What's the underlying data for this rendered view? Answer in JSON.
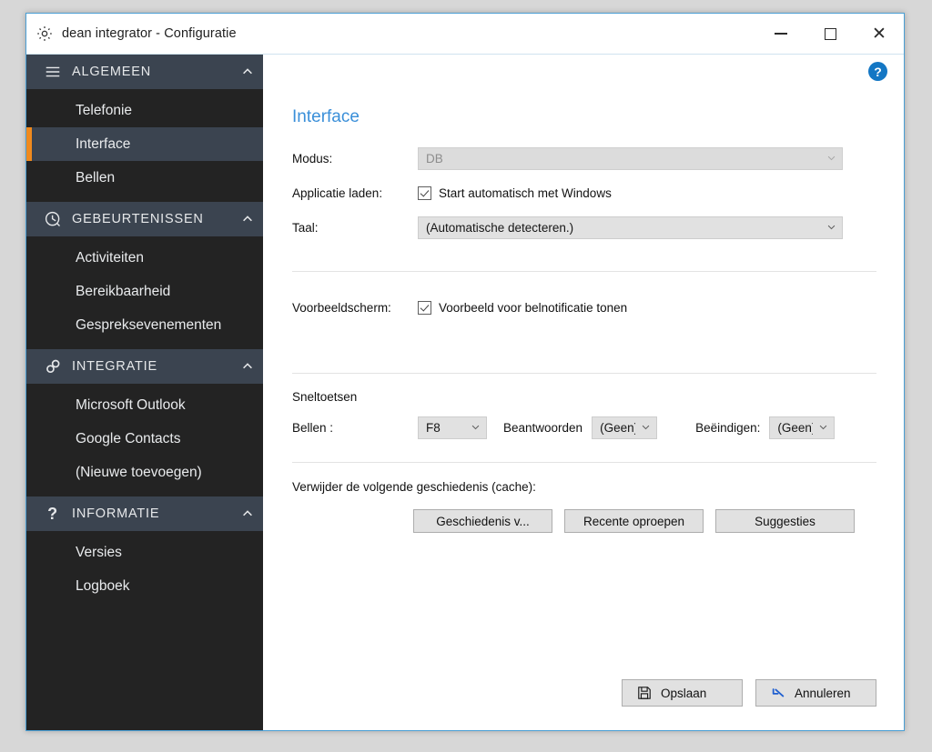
{
  "window": {
    "title": "dean integrator - Configuratie",
    "title_icon": "gear-icon",
    "minimize_label": "—",
    "maximize_label": "□",
    "close_label": "✕"
  },
  "help": {
    "label": "?"
  },
  "sidebar": {
    "sections": [
      {
        "label": "ALGEMEEN",
        "icon": "hamburger-icon",
        "chevron": "chevron-up-icon",
        "items": [
          {
            "label": "Telefonie",
            "selected": false
          },
          {
            "label": "Interface",
            "selected": true
          },
          {
            "label": "Bellen",
            "selected": false
          }
        ]
      },
      {
        "label": "GEBEURTENISSEN",
        "icon": "event-clock-icon",
        "chevron": "chevron-up-icon",
        "items": [
          {
            "label": "Activiteiten",
            "selected": false
          },
          {
            "label": "Bereikbaarheid",
            "selected": false
          },
          {
            "label": "Gespreksevenementen",
            "selected": false
          }
        ]
      },
      {
        "label": "INTEGRATIE",
        "icon": "chain-link-icon",
        "chevron": "chevron-up-icon",
        "items": [
          {
            "label": "Microsoft Outlook",
            "selected": false
          },
          {
            "label": "Google Contacts",
            "selected": false
          },
          {
            "label": "(Nieuwe toevoegen)",
            "selected": false
          }
        ]
      },
      {
        "label": "INFORMATIE",
        "icon": "question-mark-icon",
        "chevron": "chevron-up-icon",
        "items": [
          {
            "label": "Versies",
            "selected": false
          },
          {
            "label": "Logboek",
            "selected": false
          }
        ]
      }
    ]
  },
  "main": {
    "panel_title": "Interface",
    "modus": {
      "label": "Modus:",
      "value": "DB",
      "disabled": true
    },
    "applicatie_laden": {
      "label": "Applicatie laden:",
      "checkbox_label": "Start automatisch met Windows",
      "checked": true
    },
    "taal": {
      "label": "Taal:",
      "value": "(Automatische detecteren.)"
    },
    "voorbeeldscherm": {
      "label": "Voorbeeldscherm:",
      "checkbox_label": "Voorbeeld voor belnotificatie tonen",
      "checked": true
    },
    "sneltoetsen": {
      "heading": "Sneltoetsen",
      "bellen_label": "Bellen :",
      "bellen_value": "F8",
      "beantwoorden_label": "Beantwoorden",
      "beantwoorden_value": "(Geen)",
      "beeindigen_label": "Beëindigen:",
      "beeindigen_value": "(Geen)"
    },
    "cache": {
      "heading": "Verwijder de volgende geschiedenis (cache):",
      "buttons": [
        "Geschiedenis v...",
        "Recente oproepen",
        "Suggesties"
      ]
    },
    "footer": {
      "save_label": "Opslaan",
      "save_icon": "floppy-save-icon",
      "cancel_label": "Annuleren",
      "cancel_icon": "undo-arrow-icon"
    }
  },
  "colors": {
    "accent_orange": "#f08a1e",
    "sidebar_section": "#3b4450",
    "sidebar_item_bg": "#232323",
    "title_link_blue": "#3a8fd9",
    "help_blue": "#1477c4",
    "window_border": "#4a9fd4"
  }
}
